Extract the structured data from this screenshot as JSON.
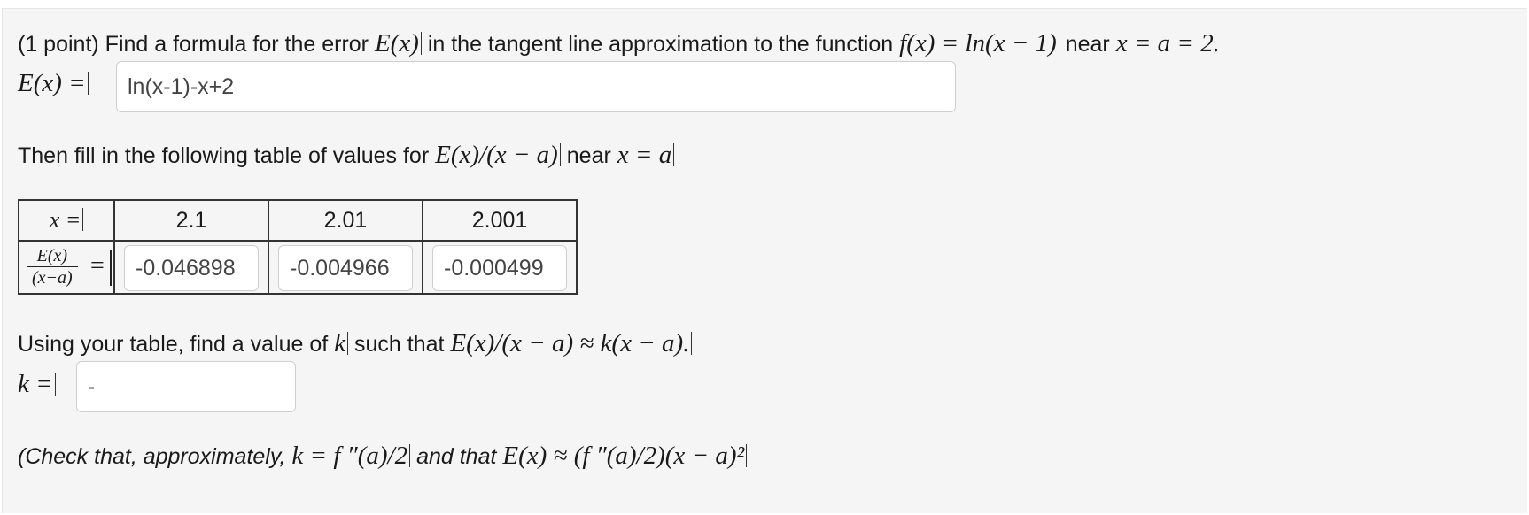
{
  "problem": {
    "points": "(1 point)",
    "intro": "Find a formula for the error",
    "error_fn": "E(x)",
    "mid": "in the tangent line approximation to the function",
    "function": "f(x) = ln(x − 1)",
    "near": "near",
    "point": "x = a = 2."
  },
  "formula_row": {
    "label": "E(x) =",
    "value": "ln(x-1)-x+2"
  },
  "table_intro": {
    "text": "Then fill in the following table of values for",
    "expr": "E(x)/(x − a)",
    "near": "near",
    "point": "x = a"
  },
  "table": {
    "header_label": "x =",
    "x_values": [
      "2.1",
      "2.01",
      "2.001"
    ],
    "row_label_num": "E(x)",
    "row_label_den": "(x−a)",
    "row_eq": "=",
    "answers": [
      "-0.046898",
      "-0.004966",
      "-0.000499"
    ]
  },
  "k_question": {
    "text1": "Using your table, find a value of",
    "var": "k",
    "text2": "such that",
    "expr": "E(x)/(x − a) ≈ k(x − a).",
    "label": "k =",
    "value": "-"
  },
  "check": {
    "text1": "(Check that, approximately,",
    "expr1": "k = f ″(a)/2",
    "text2": "and that",
    "expr2": "E(x) ≈ (f ″(a)/2)(x − a)²"
  }
}
